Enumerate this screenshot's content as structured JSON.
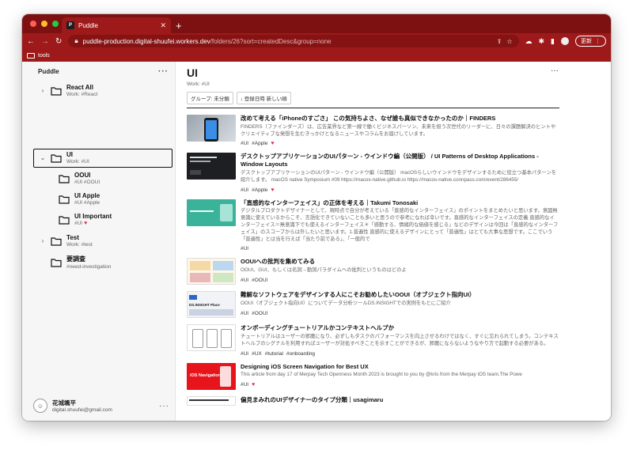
{
  "browser": {
    "tab_title": "Puddle",
    "url_host": "puddle-production.digital-shuufei.workers.dev",
    "url_path": "/folders/26?sort=createdDesc&group=none",
    "update_label": "更新",
    "bookmark": "tools"
  },
  "sidebar": {
    "title": "Puddle",
    "folders": [
      {
        "name": "React All",
        "sub": "Work: #React"
      },
      {
        "name": "UI",
        "sub": "Work: #UI"
      },
      {
        "name": "OOUI",
        "sub": "#UI #OOUI"
      },
      {
        "name": "UI Apple",
        "sub": "#UI #Apple"
      },
      {
        "name": "UI Important",
        "sub": "#UI"
      },
      {
        "name": "Test",
        "sub": "Work: #test"
      },
      {
        "name": "要調査",
        "sub": "#need-investigation"
      }
    ],
    "user": {
      "name": "花城颯平",
      "email": "digital.shuufei@gmail.com"
    }
  },
  "main": {
    "title": "UI",
    "subtitle": "Work: #UI",
    "group_chip": "グループ: 未分類",
    "sort_chip": "登録日時 新しい順",
    "items": [
      {
        "title": "改めて考える「iPhoneのすごさ」 この気持ちよさ、なぜ誰も真似できなかったのか｜FINDERS",
        "desc": "FINDERS（ファインダーズ）は、広告業界など第一線で働くビジネスパーソン、未来を担う次世代のリーダーに、日々の課題解決のヒントやクリエイティブな発想を生むきっかけとなるニュースやコラムをお届けしています。",
        "tags": [
          "#UI",
          "#Apple"
        ],
        "fav": true
      },
      {
        "title": "デスクトップアプリケーションのUIパターン - ウインドウ編（公開版） / UI Patterns of Desktop Applications - Window Layouts",
        "desc": "デスクトップアプリケーションのUIパターン - ウインドウ編（公開版） macOSらしいウインドウをデザインするために役立つ基本パターンを紹介します。 macOS native Symposium #09 https://macos-native.github.io https://macos-native.connpass.com/event/286455/",
        "tags": [
          "#UI",
          "#Apple"
        ],
        "fav": true
      },
      {
        "title": "「直感的なインターフェイス」の正体を考える｜Takumi Tonosaki",
        "desc": "デジタルプロダクトデザイナーとして、現時点で自分が考えている「直感的なインターフェイス」のポイントをまとめたいと思います。意図無意識に使えているからこそ、言語化できていないことも多いと思うので参考になれば幸いです。直感的なインターフェイスの定義 直感的なインターフェイス＝無意識下でも使えるインターフェイス＊「感動する、情緒的な価値を感じる」などのデザインは今回は「直感的なインターフェイス」のスコープからは外したいと思います。1.普遍性 直感的に使えるデザインにとって「普遍性」はとても大事な思想です。ここでいう「普遍性」とは当を行えば「当たり前である」、「一般的で",
        "tags": [
          "#UI"
        ],
        "fav": false
      },
      {
        "title": "OOUIへの批判を集めてみる",
        "desc": "OOUI、GUI、もしくは名詞→動詞パラダイムへの批判というものはどのよ",
        "tags": [
          "#UI",
          "#OOUI"
        ],
        "fav": false
      },
      {
        "title": "難解なソフトウェアをデザインする人にこそお勧めしたいOOUI（オブジェクト指向UI）",
        "desc": "OOUI（オブジェクト指向UI）についてデータ分析ツールDS.INSIGHTでの実例をもとにご紹介",
        "tags": [
          "#UI",
          "#OOUI"
        ],
        "fav": false
      },
      {
        "title": "オンボーディングチュートリアルかコンテキストヘルプか",
        "desc": "チュートリアルはユーザーの邪魔になり、必ずしもタスクのパフォーマンスを向上させるわけではなく、すぐに忘れられてしまう。コンテキストヘルプのシグナルを利用すればユーザーが対処すべきことを示すことができるが、邪魔にならないようなやり方で起動する必要がある。",
        "tags": [
          "#UI",
          "#UX",
          "#tutorial",
          "#onboarding"
        ],
        "fav": false
      },
      {
        "title": "Designing iOS Screen Navigation for Best UX",
        "desc": "This article from day 17 of Merpay Tech Openness Month 2023 is brought to you by @kris from the Merpay iOS team.The Powe",
        "tags": [
          "#UI"
        ],
        "fav": true
      },
      {
        "title": "偏見まみれのUIデザイナーのタイプ分類｜usagimaru",
        "desc": "",
        "tags": [],
        "fav": false
      }
    ]
  },
  "thumb_labels": {
    "t4": "DS.INSIGHT Place",
    "t6": "iOS Navigation"
  }
}
